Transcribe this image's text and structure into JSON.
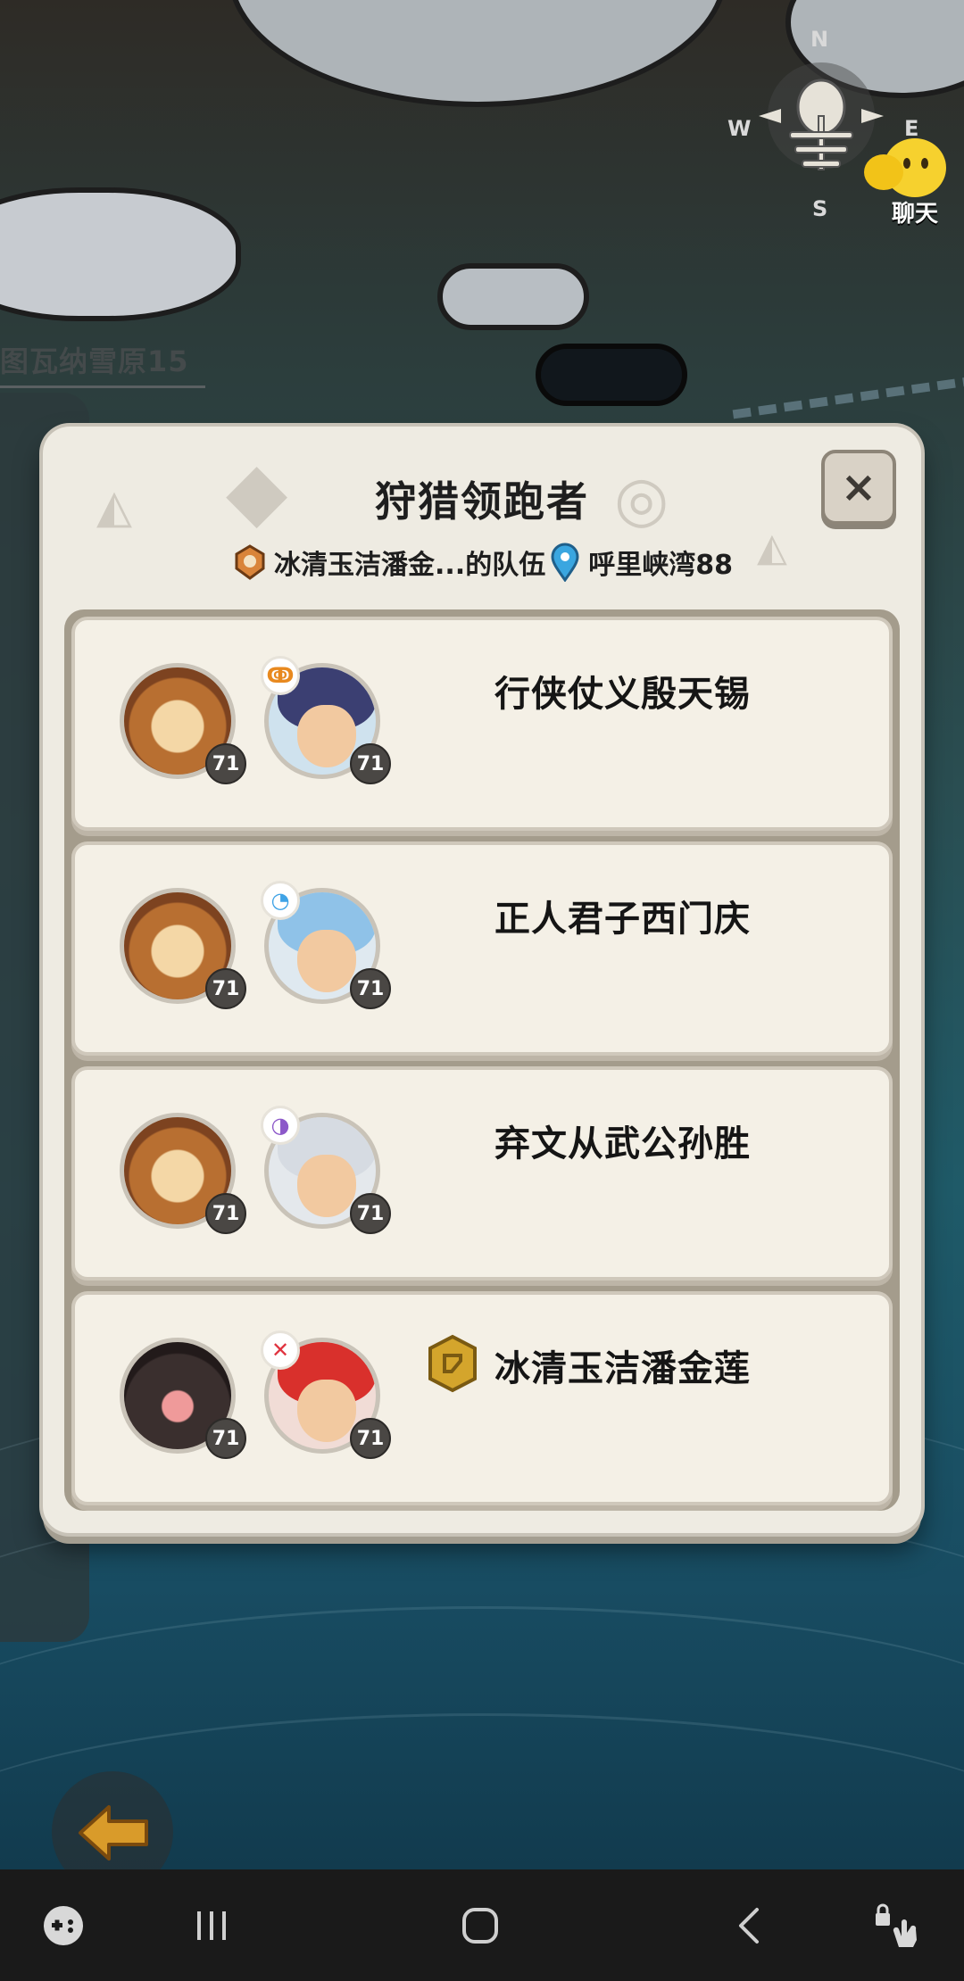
{
  "map": {
    "zone_label": "图瓦纳雪原15",
    "compass": {
      "north": "N",
      "south": "S",
      "west": "W",
      "east": "E"
    },
    "chat_label": "聊天"
  },
  "dialog": {
    "title": "狩猎领跑者",
    "team_name": "冰清玉洁潘金...的队伍",
    "location": "呼里峡湾88",
    "close_label": "×",
    "members": [
      {
        "name": "行侠仗义殷天锡",
        "mount_level": "71",
        "hero_level": "71",
        "element_icon": "fire-element-icon",
        "element_color": "#e8891f",
        "hair_color": "#3b3f72",
        "is_leader": false
      },
      {
        "name": "正人君子西门庆",
        "mount_level": "71",
        "hero_level": "71",
        "element_icon": "water-element-icon",
        "element_color": "#3fa3e6",
        "hair_color": "#8fc2e8",
        "is_leader": false
      },
      {
        "name": "弃文从武公孙胜",
        "mount_level": "71",
        "hero_level": "71",
        "element_icon": "arcane-element-icon",
        "element_color": "#8c58c9",
        "hair_color": "#d6dbe2",
        "is_leader": false
      },
      {
        "name": "冰清玉洁潘金莲",
        "mount_level": "71",
        "hero_level": "71",
        "element_icon": "blood-element-icon",
        "element_color": "#e0333f",
        "hair_color": "#d9302c",
        "is_leader": true
      }
    ]
  },
  "colors": {
    "dialog_bg": "#eeebe2",
    "leader_badge": "#d4a52c",
    "level_badge": "#4a4744"
  }
}
